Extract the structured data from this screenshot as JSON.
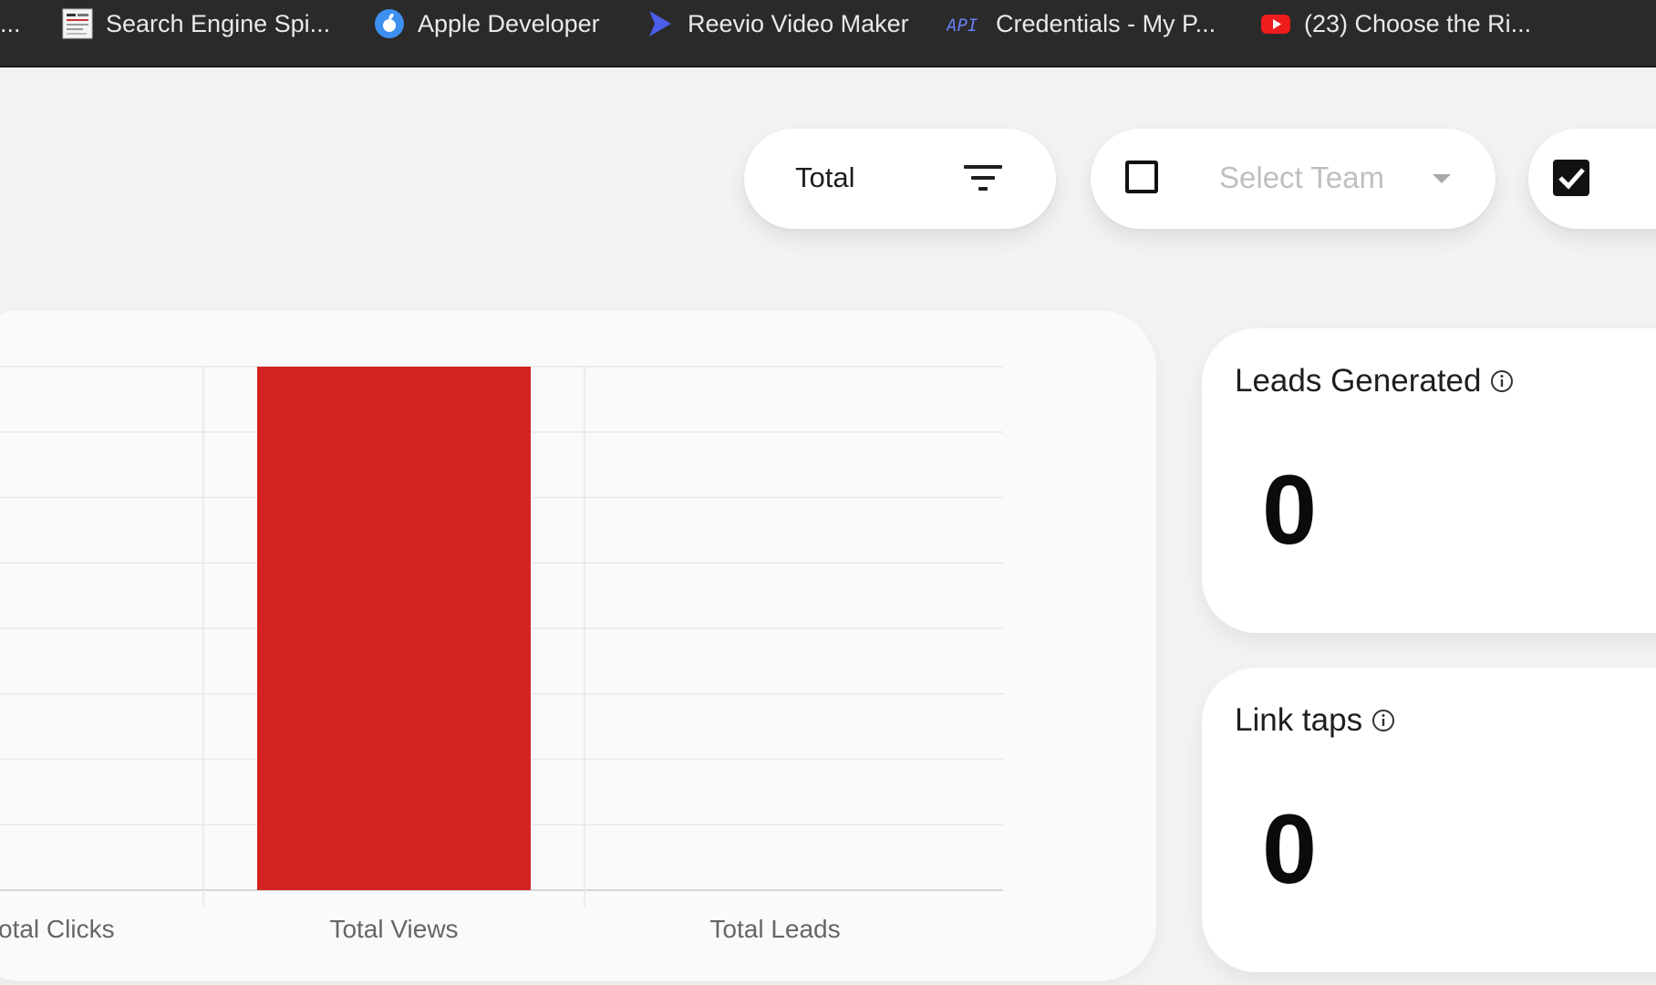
{
  "bookmarks_bar": {
    "overflow_label": "...",
    "items": [
      {
        "label": "Search Engine Spi...",
        "icon": "site-thumbnail-icon"
      },
      {
        "label": "Apple Developer",
        "icon": "apple-developer-icon"
      },
      {
        "label": "Reevio Video Maker",
        "icon": "reevio-play-icon"
      },
      {
        "label": "Credentials - My P...",
        "icon": "api-icon",
        "icon_text": "API"
      },
      {
        "label": "(23) Choose the Ri...",
        "icon": "youtube-icon"
      }
    ]
  },
  "filters": {
    "total_label": "Total",
    "team_placeholder": "Select Team",
    "team_checkbox_checked": false,
    "right_checkbox_checked": true
  },
  "chart_data": {
    "type": "bar",
    "categories": [
      "Total Clicks",
      "Total Views",
      "Total Leads"
    ],
    "visible_category_labels": [
      "otal Clicks",
      "Total Views",
      "Total Leads"
    ],
    "values": [
      0,
      1,
      0
    ],
    "ylim": [
      0,
      1
    ],
    "grid": true,
    "bar_color": "#d32421"
  },
  "stats": {
    "leads_generated": {
      "title": "Leads Generated",
      "value": "0"
    },
    "link_taps": {
      "title": "Link taps",
      "value": "0"
    }
  },
  "colors": {
    "background": "#f3f3f3",
    "bookmark_bar": "#2a2a2a",
    "accent_red": "#d32421"
  }
}
